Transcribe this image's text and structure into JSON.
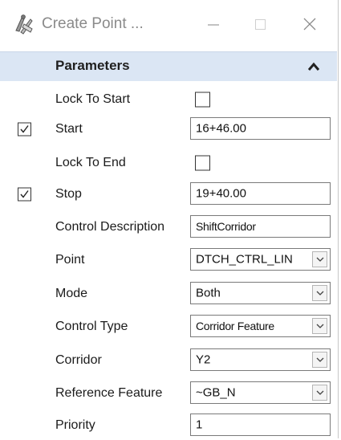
{
  "window": {
    "title": "Create Point ...",
    "app_icon": "rulers-compass-icon",
    "minimize_icon": "minimize-icon",
    "maximize_icon": "maximize-icon",
    "close_icon": "close-icon"
  },
  "panel": {
    "title": "Parameters",
    "collapse_icon": "chevron-up-icon",
    "header_bg": "#dbe6f4"
  },
  "rows": [
    {
      "label": "Lock To Start",
      "checkbox": false
    },
    {
      "label": "Start",
      "enabled": true,
      "value": "16+46.00"
    },
    {
      "label": "Lock To End",
      "checkbox": false
    },
    {
      "label": "Stop",
      "enabled": true,
      "value": "19+40.00"
    },
    {
      "label": "Control Description",
      "value": "ShiftCorridor"
    },
    {
      "label": "Point",
      "value": "DTCH_CTRL_LIN"
    },
    {
      "label": "Mode",
      "value": "Both"
    },
    {
      "label": "Control Type",
      "value": "Corridor Feature"
    },
    {
      "label": "Corridor",
      "value": "Y2"
    },
    {
      "label": "Reference Feature",
      "value": "~GB_N"
    },
    {
      "label": "Priority",
      "value": "1"
    }
  ]
}
